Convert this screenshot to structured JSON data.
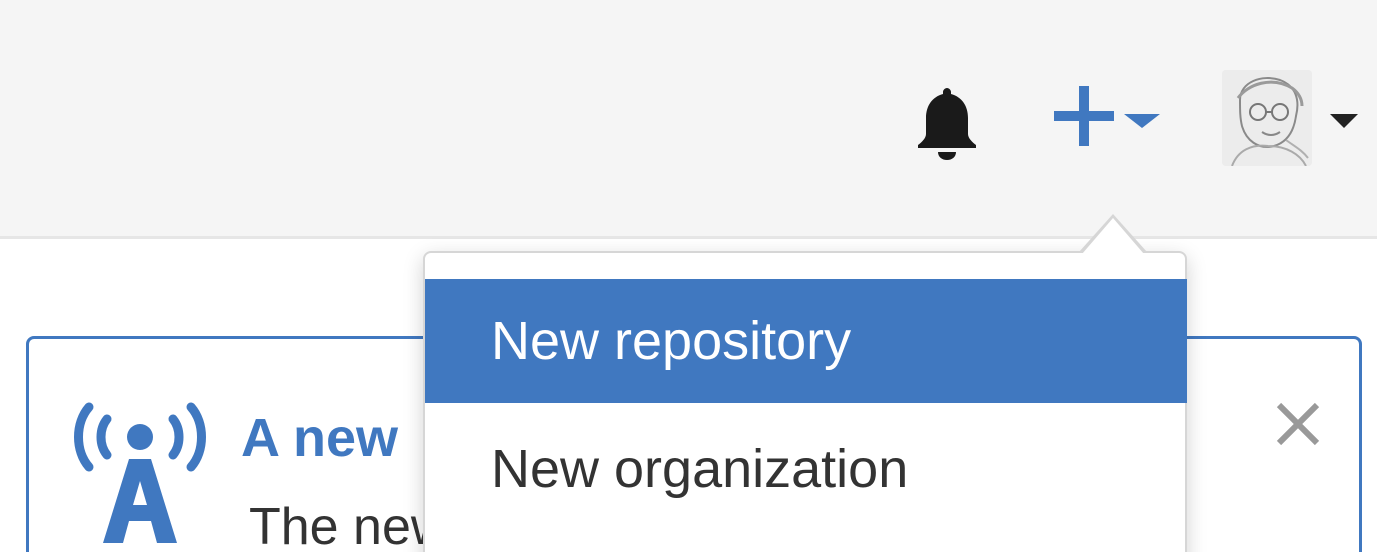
{
  "header": {
    "icons": {
      "notifications": "bell-icon",
      "create": "plus-icon",
      "create_caret": "caret-down-icon",
      "avatar_caret": "caret-down-icon"
    }
  },
  "create_menu": {
    "items": [
      {
        "label": "New repository",
        "state": "highlighted"
      },
      {
        "label": "New organization",
        "state": "normal"
      }
    ]
  },
  "announcement": {
    "icon": "broadcast-icon",
    "title_visible": "A new",
    "body_visible": "The new",
    "close_icon": "close-icon"
  },
  "colors": {
    "accent_blue": "#4078c0",
    "header_bg": "#f5f5f5",
    "menu_text": "#333333",
    "close_gray": "#999999"
  }
}
